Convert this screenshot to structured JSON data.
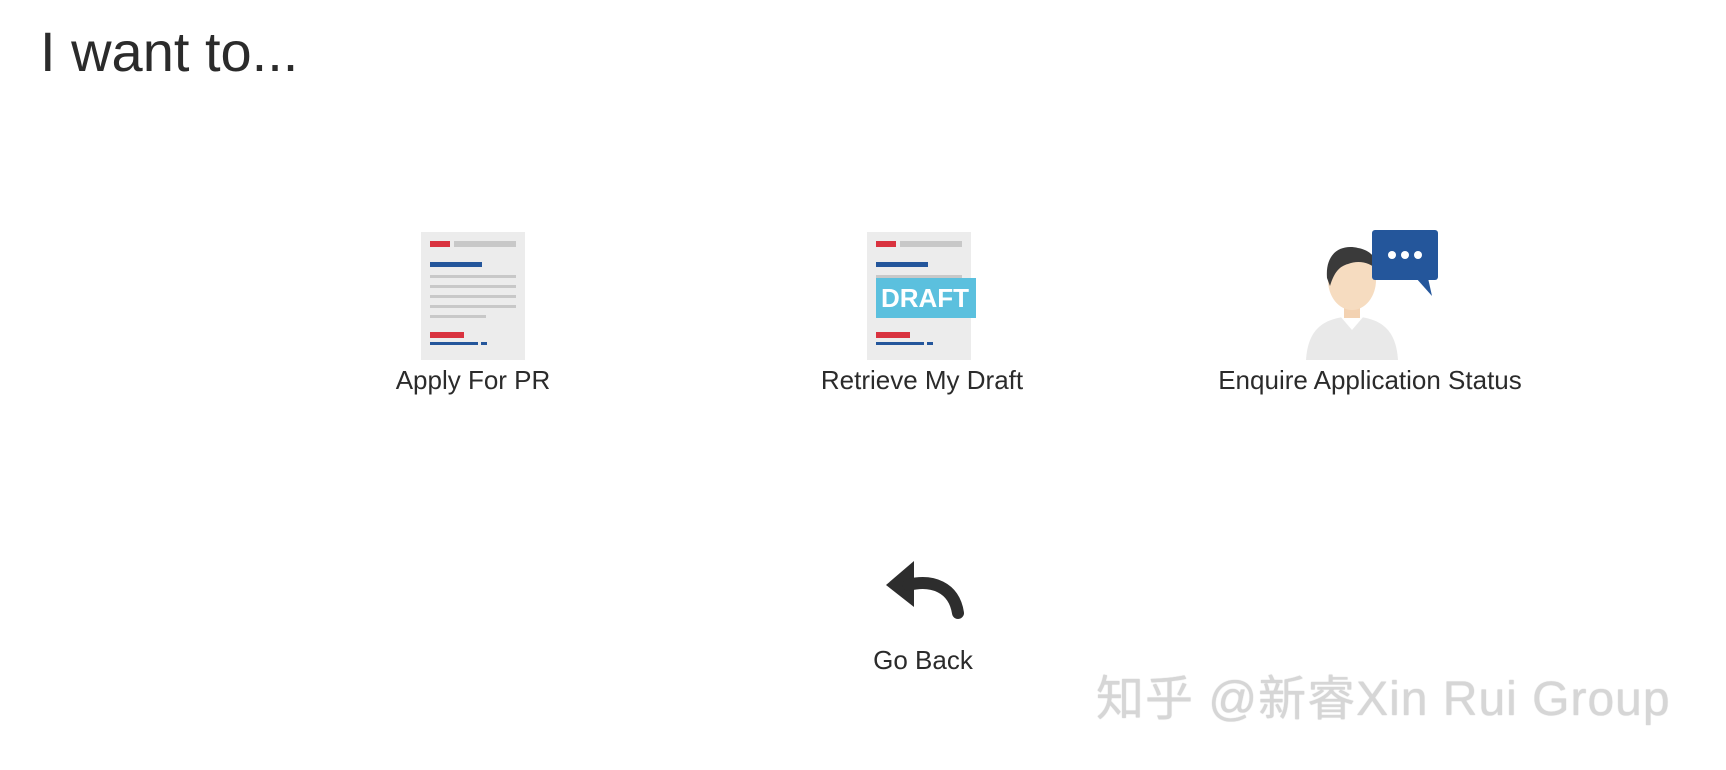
{
  "header": {
    "title": "I want to..."
  },
  "options": [
    {
      "label": "Apply For PR",
      "icon": "application-form-icon"
    },
    {
      "label": "Retrieve My Draft",
      "icon": "draft-document-icon",
      "badge": "DRAFT"
    },
    {
      "label": "Enquire Application Status",
      "icon": "enquiry-person-icon"
    }
  ],
  "navigation": {
    "back_label": "Go Back",
    "back_icon": "reply-arrow-icon"
  },
  "watermark": {
    "text": "知乎 @新睿Xin Rui Group"
  },
  "colors": {
    "doc_red": "#d9333f",
    "doc_blue": "#24569b",
    "doc_gray": "#c8c8c8",
    "doc_paper": "#ececec",
    "draft_badge": "#5bc0de",
    "chat_bubble": "#24569b",
    "arrow": "#2d2d2d"
  }
}
